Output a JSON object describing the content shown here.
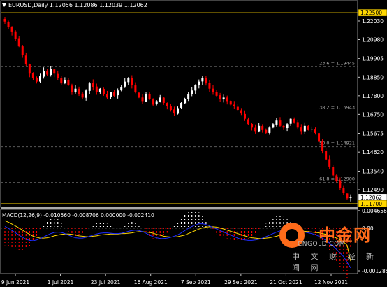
{
  "header": {
    "symbol_line": "EURUSD,Daily  1.12056 1.12086 1.12039 1.12062"
  },
  "macd": {
    "label": "MACD(12,26,9) -0.010560 -0.008706 0.000000 -0.002410"
  },
  "watermark": {
    "logo": "中金网",
    "domain": "CNGOLD.COM",
    "tagline": "中 文 财 经 新 闻 网"
  },
  "colors": {
    "background": "#000000",
    "grid": "#5a5a5a",
    "bull_candle": "#ffffff",
    "bear_candle": "#ff0000",
    "level_line": "#ffd700",
    "macd_hist_pos": "#ffffff",
    "macd_hist_neg": "#ff0000",
    "macd_signal": "#ffd700",
    "macd_main": "#1e2dff"
  },
  "chart_data": {
    "type": "candlestick",
    "price_axis_ticks": [
      "1.22030",
      "1.20980",
      "1.19905",
      "1.18850",
      "1.17800",
      "1.16750",
      "1.15675",
      "1.14620",
      "1.13540",
      "1.12490"
    ],
    "price_tags": [
      {
        "text": "1.22500",
        "value": 1.225,
        "style": "level"
      },
      {
        "text": "1.12062",
        "value": 1.12062,
        "style": "current"
      },
      {
        "text": "1.11700",
        "value": 1.117,
        "style": "level"
      }
    ],
    "fibo_levels": [
      {
        "label": "23.6 = 1.19445",
        "value": 1.19445
      },
      {
        "label": "38.2 = 1.16943",
        "value": 1.16943
      },
      {
        "label": "50.0 = 1.14921",
        "value": 1.14921
      },
      {
        "label": "61.8 = 1.12900",
        "value": 1.129
      }
    ],
    "horizontal_levels": [
      1.225,
      1.117
    ],
    "date_labels": [
      "9 Jun 2021",
      "1 Jul 2021",
      "23 Jul 2021",
      "16 Aug 2021",
      "7 Sep 2021",
      "29 Sep 2021",
      "21 Oct 2021",
      "12 Nov 2021"
    ],
    "macd_axis_ticks": [
      "0.004656",
      "0.00",
      "-0.001285"
    ],
    "closes": [
      1.22,
      1.217,
      1.214,
      1.21,
      1.206,
      1.201,
      1.196,
      1.1905,
      1.188,
      1.186,
      1.189,
      1.192,
      1.19,
      1.193,
      1.1905,
      1.188,
      1.185,
      1.187,
      1.184,
      1.18,
      1.182,
      1.179,
      1.177,
      1.181,
      1.185,
      1.183,
      1.18,
      1.182,
      1.179,
      1.177,
      1.18,
      1.178,
      1.181,
      1.183,
      1.186,
      1.188,
      1.184,
      1.18,
      1.177,
      1.175,
      1.179,
      1.176,
      1.173,
      1.175,
      1.177,
      1.174,
      1.172,
      1.17,
      1.168,
      1.171,
      1.174,
      1.176,
      1.179,
      1.181,
      1.184,
      1.186,
      1.188,
      1.185,
      1.182,
      1.18,
      1.178,
      1.176,
      1.177,
      1.175,
      1.173,
      1.172,
      1.17,
      1.168,
      1.165,
      1.162,
      1.16,
      1.158,
      1.161,
      1.159,
      1.157,
      1.16,
      1.162,
      1.164,
      1.161,
      1.16,
      1.162,
      1.165,
      1.163,
      1.16,
      1.158,
      1.161,
      1.159,
      1.159,
      1.157,
      1.152,
      1.147,
      1.142,
      1.138,
      1.133,
      1.13,
      1.126,
      1.123,
      1.12,
      1.1206
    ],
    "macd_main": [
      0.0005,
      0.0,
      -0.0006,
      -0.0012,
      -0.0018,
      -0.0024,
      -0.0029,
      -0.0032,
      -0.0033,
      -0.0031,
      -0.0027,
      -0.0023,
      -0.0018,
      -0.0014,
      -0.0011,
      -0.001,
      -0.0011,
      -0.0014,
      -0.0018,
      -0.0022,
      -0.0025,
      -0.0026,
      -0.0026,
      -0.0024,
      -0.0021,
      -0.0018,
      -0.0015,
      -0.0013,
      -0.0012,
      -0.0012,
      -0.0013,
      -0.0014,
      -0.0014,
      -0.0013,
      -0.0011,
      -0.0008,
      -0.0006,
      -0.0005,
      -0.0006,
      -0.0009,
      -0.0013,
      -0.0018,
      -0.0022,
      -0.0025,
      -0.0027,
      -0.0027,
      -0.0026,
      -0.0024,
      -0.0021,
      -0.0017,
      -0.0012,
      -0.0006,
      0.0,
      0.0005,
      0.0009,
      0.0012,
      0.0012,
      0.001,
      0.0006,
      0.0002,
      -0.0002,
      -0.0006,
      -0.001,
      -0.0014,
      -0.0018,
      -0.0022,
      -0.0026,
      -0.0029,
      -0.0031,
      -0.0032,
      -0.0032,
      -0.0031,
      -0.0029,
      -0.0026,
      -0.0022,
      -0.0018,
      -0.0014,
      -0.001,
      -0.0007,
      -0.0005,
      -0.0004,
      -0.0004,
      -0.0005,
      -0.0006,
      -0.0008,
      -0.001,
      -0.0012,
      -0.0014,
      -0.0017,
      -0.0021,
      -0.0026,
      -0.0032,
      -0.0039,
      -0.0047,
      -0.0056,
      -0.0065,
      -0.0075,
      -0.009,
      -0.0105
    ],
    "macd_signal": [
      0.002,
      0.0016,
      0.0011,
      0.0006,
      0.0001,
      -0.0005,
      -0.0011,
      -0.0016,
      -0.0021,
      -0.0024,
      -0.0026,
      -0.0026,
      -0.0025,
      -0.0023,
      -0.002,
      -0.0018,
      -0.0016,
      -0.0015,
      -0.0015,
      -0.0016,
      -0.0018,
      -0.002,
      -0.0021,
      -0.0022,
      -0.0022,
      -0.0021,
      -0.002,
      -0.0018,
      -0.0017,
      -0.0016,
      -0.0015,
      -0.0015,
      -0.0015,
      -0.0014,
      -0.0014,
      -0.0013,
      -0.0012,
      -0.001,
      -0.0009,
      -0.0009,
      -0.001,
      -0.0011,
      -0.0013,
      -0.0016,
      -0.0018,
      -0.0021,
      -0.0022,
      -0.0023,
      -0.0023,
      -0.0022,
      -0.002,
      -0.0018,
      -0.0014,
      -0.001,
      -0.0006,
      -0.0002,
      0.0001,
      0.0003,
      0.0004,
      0.0004,
      0.0003,
      0.0001,
      -0.0002,
      -0.0005,
      -0.0008,
      -0.0011,
      -0.0014,
      -0.0017,
      -0.002,
      -0.0023,
      -0.0025,
      -0.0026,
      -0.0027,
      -0.0027,
      -0.0026,
      -0.0025,
      -0.0023,
      -0.0021,
      -0.0018,
      -0.0015,
      -0.0012,
      -0.001,
      -0.0009,
      -0.0008,
      -0.0008,
      -0.0008,
      -0.0009,
      -0.001,
      -0.0011,
      -0.0012,
      -0.0014,
      -0.0016,
      -0.0019,
      -0.0022,
      -0.0026,
      -0.0031,
      -0.0036,
      -0.0045,
      -0.0087
    ]
  }
}
